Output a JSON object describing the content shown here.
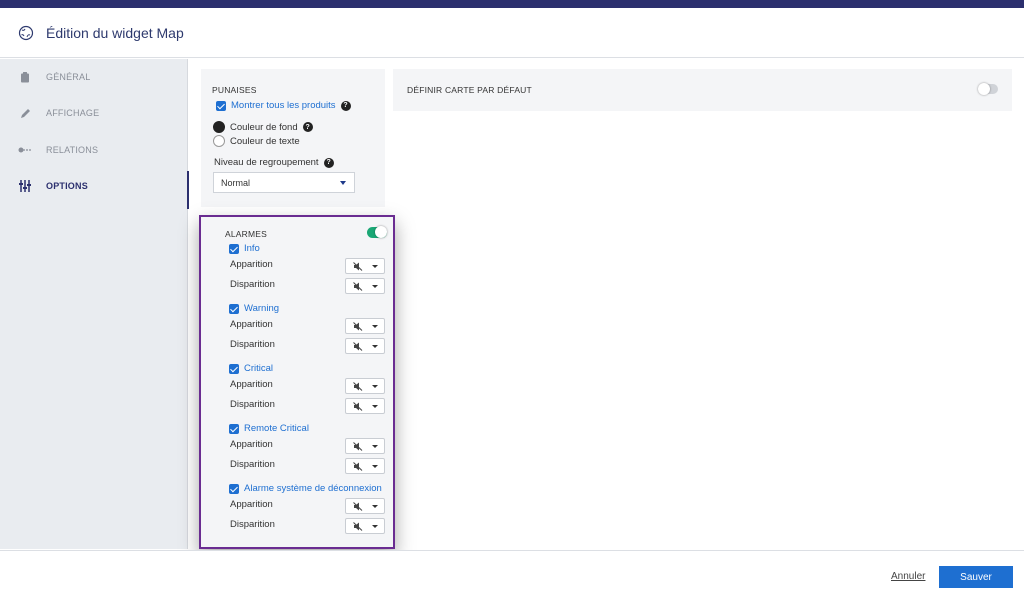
{
  "header": {
    "title": "Édition du widget Map"
  },
  "sidebar": {
    "items": [
      {
        "label": "GÉNÉRAL",
        "icon": "clipboard-icon"
      },
      {
        "label": "AFFICHAGE",
        "icon": "pencil-icon"
      },
      {
        "label": "RELATIONS",
        "icon": "link-icon"
      },
      {
        "label": "OPTIONS",
        "icon": "sliders-icon",
        "active": true
      }
    ]
  },
  "punaises": {
    "title": "PUNAISES",
    "show_all_label": "Montrer tous les produits",
    "show_all_checked": true,
    "bg_color_label": "Couleur de fond",
    "text_color_label": "Couleur de texte",
    "selected_color_mode": "Couleur de fond",
    "grouping_label": "Niveau de regroupement",
    "grouping_value": "Normal"
  },
  "carte": {
    "title": "DÉFINIR CARTE PAR DÉFAUT",
    "enabled": false
  },
  "alarmes": {
    "title": "ALARMES",
    "enabled": true,
    "appear_label": "Apparition",
    "disappear_label": "Disparition",
    "sound_icon": "muted-speaker-icon",
    "categories": [
      {
        "label": "Info",
        "checked": true
      },
      {
        "label": "Warning",
        "checked": true
      },
      {
        "label": "Critical",
        "checked": true
      },
      {
        "label": "Remote Critical",
        "checked": true
      },
      {
        "label": "Alarme système de déconnexion",
        "checked": true
      }
    ]
  },
  "footer": {
    "cancel_label": "Annuler",
    "save_label": "Sauver"
  },
  "colors": {
    "brand": "#2b2f6e",
    "accent": "#1e6fd1",
    "toggle_on": "#1aa775",
    "highlight_border": "#6a2c91"
  }
}
